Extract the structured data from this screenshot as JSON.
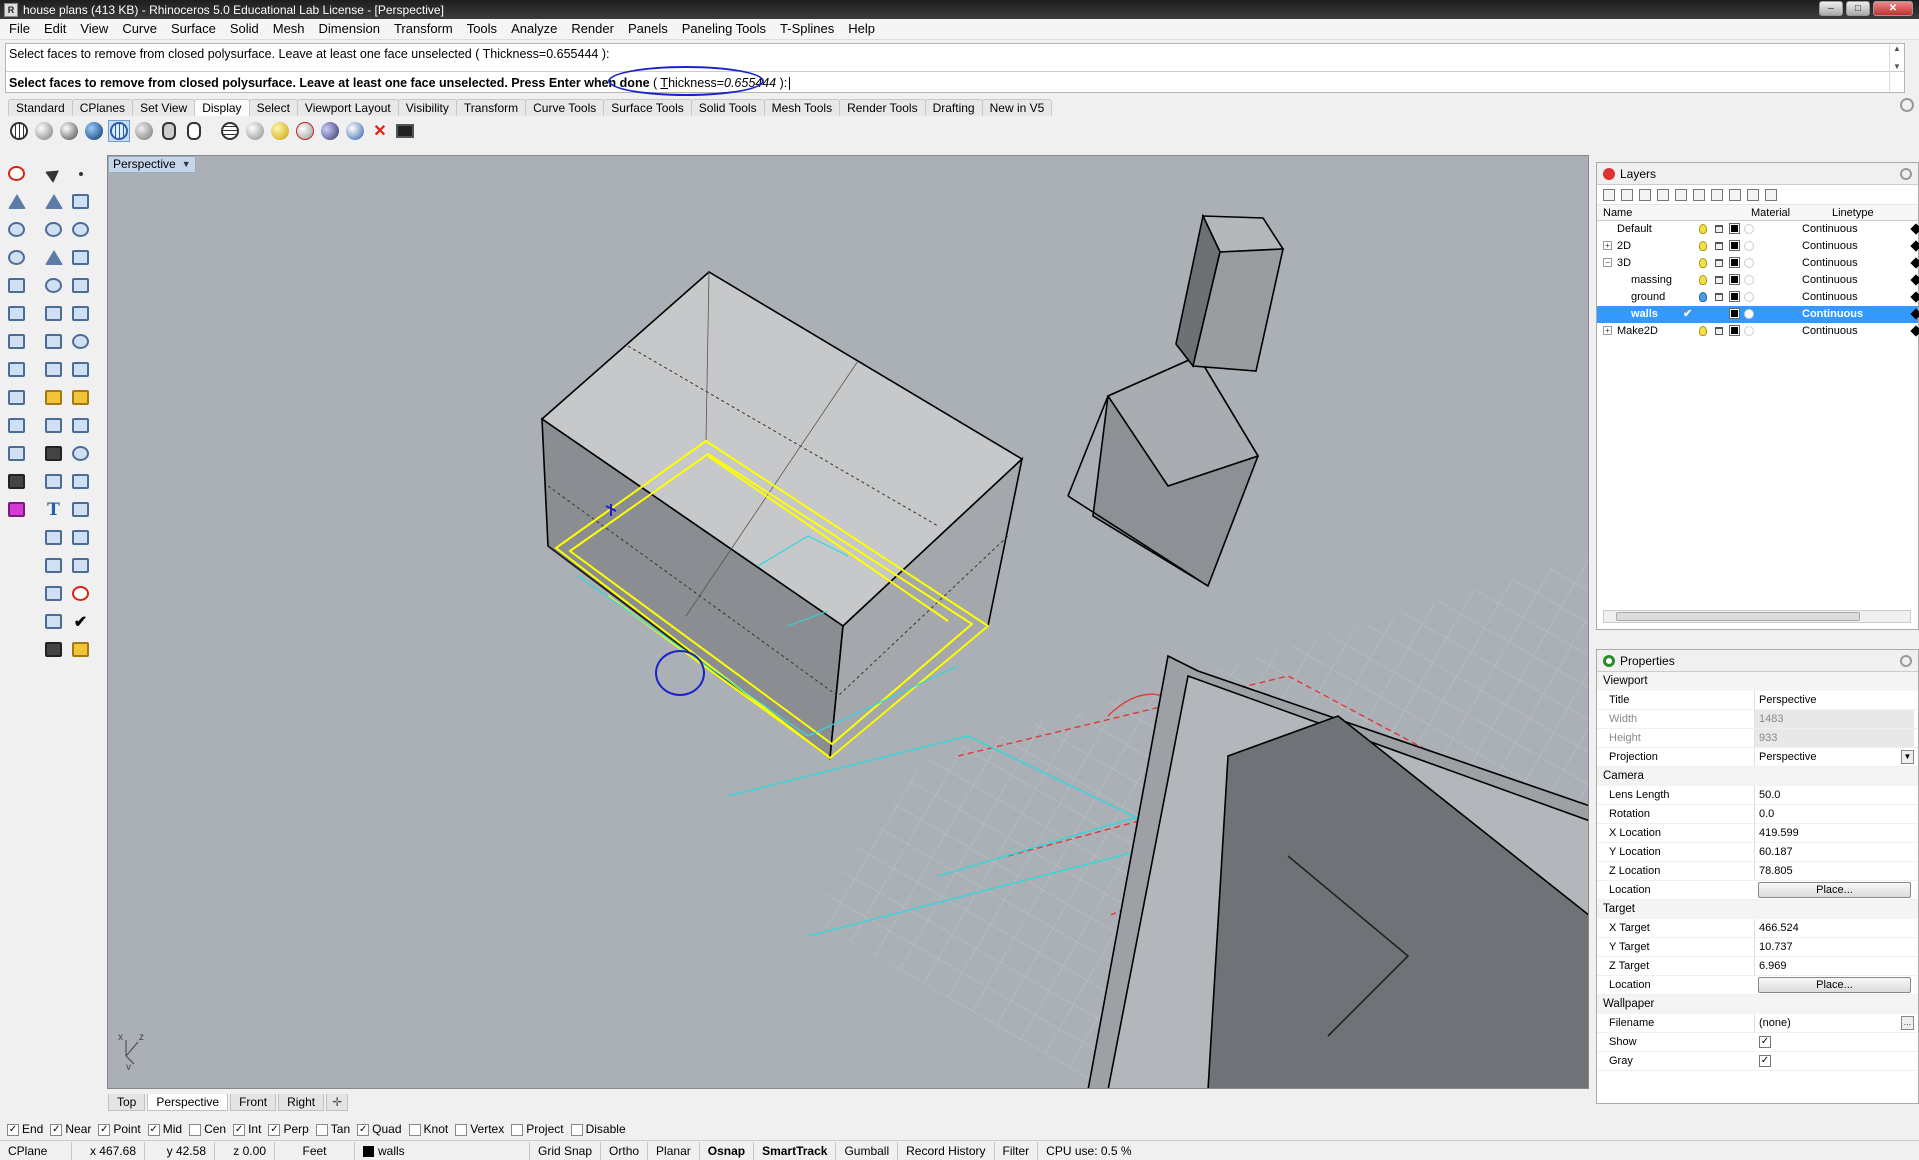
{
  "window": {
    "title": "house plans (413 KB) - Rhinoceros 5.0 Educational Lab License - [Perspective]"
  },
  "menu": [
    "File",
    "Edit",
    "View",
    "Curve",
    "Surface",
    "Solid",
    "Mesh",
    "Dimension",
    "Transform",
    "Tools",
    "Analyze",
    "Render",
    "Panels",
    "Paneling Tools",
    "T-Splines",
    "Help"
  ],
  "command": {
    "history": "Select faces to remove from closed polysurface. Leave at least one face unselected ( Thickness=0.655444 ):",
    "prompt": "Select faces to remove from closed polysurface. Leave at least one face unselected. Press Enter when done",
    "option_open": " ( ",
    "option_key": "T",
    "option_rest": "hickness=",
    "option_value": "0.655444",
    "option_close": " ):"
  },
  "toolbar_tabs": [
    "Standard",
    "CPlanes",
    "Set View",
    "Display",
    "Select",
    "Viewport Layout",
    "Visibility",
    "Transform",
    "Curve Tools",
    "Surface Tools",
    "Solid Tools",
    "Mesh Tools",
    "Render Tools",
    "Drafting",
    "New in V5"
  ],
  "active_toolbar_tab": "Display",
  "viewport": {
    "name": "Perspective",
    "tabs": [
      "Top",
      "Perspective",
      "Front",
      "Right"
    ],
    "active_tab": "Perspective",
    "axis_labels": {
      "x": "x",
      "y": "y",
      "z": "z"
    }
  },
  "layers": {
    "title": "Layers",
    "columns": {
      "name": "Name",
      "material": "Material",
      "linetype": "Linetype"
    },
    "rows": [
      {
        "name": "Default",
        "linetype": "Continuous",
        "expander": "",
        "indent": 0,
        "current": false,
        "selected": false
      },
      {
        "name": "2D",
        "linetype": "Continuous",
        "expander": "+",
        "indent": 0,
        "current": false,
        "selected": false
      },
      {
        "name": "3D",
        "linetype": "Continuous",
        "expander": "−",
        "indent": 0,
        "current": false,
        "selected": false
      },
      {
        "name": "massing",
        "linetype": "Continuous",
        "expander": "",
        "indent": 1,
        "current": false,
        "selected": false
      },
      {
        "name": "ground",
        "linetype": "Continuous",
        "expander": "",
        "indent": 1,
        "current": false,
        "selected": false
      },
      {
        "name": "walls",
        "linetype": "Continuous",
        "expander": "",
        "indent": 1,
        "current": true,
        "selected": true
      },
      {
        "name": "Make2D",
        "linetype": "Continuous",
        "expander": "+",
        "indent": 0,
        "current": false,
        "selected": false
      }
    ]
  },
  "properties": {
    "title": "Properties",
    "viewport_section": "Viewport",
    "title_label": "Title",
    "title_value": "Perspective",
    "width_label": "Width",
    "width_value": "1483",
    "height_label": "Height",
    "height_value": "933",
    "projection_label": "Projection",
    "projection_value": "Perspective",
    "camera_section": "Camera",
    "lens_label": "Lens Length",
    "lens_value": "50.0",
    "rotation_label": "Rotation",
    "rotation_value": "0.0",
    "xloc_label": "X Location",
    "xloc_value": "419.599",
    "yloc_label": "Y Location",
    "yloc_value": "60.187",
    "zloc_label": "Z Location",
    "zloc_value": "78.805",
    "location_label": "Location",
    "place_label": "Place...",
    "target_section": "Target",
    "xtarget_label": "X Target",
    "xtarget_value": "466.524",
    "ytarget_label": "Y Target",
    "ytarget_value": "10.737",
    "ztarget_label": "Z Target",
    "ztarget_value": "6.969",
    "target_location_label": "Location",
    "target_place_label": "Place...",
    "wallpaper_section": "Wallpaper",
    "filename_label": "Filename",
    "filename_value": "(none)",
    "show_label": "Show",
    "show_checked": true,
    "gray_label": "Gray",
    "gray_checked": true
  },
  "osnaps": [
    {
      "label": "End",
      "checked": true
    },
    {
      "label": "Near",
      "checked": true
    },
    {
      "label": "Point",
      "checked": true
    },
    {
      "label": "Mid",
      "checked": true
    },
    {
      "label": "Cen",
      "checked": false
    },
    {
      "label": "Int",
      "checked": true
    },
    {
      "label": "Perp",
      "checked": true
    },
    {
      "label": "Tan",
      "checked": false
    },
    {
      "label": "Quad",
      "checked": true
    },
    {
      "label": "Knot",
      "checked": false
    },
    {
      "label": "Vertex",
      "checked": false
    },
    {
      "label": "Project",
      "checked": false
    },
    {
      "label": "Disable",
      "checked": false
    }
  ],
  "status": {
    "cplane": "CPlane",
    "x": "x 467.68",
    "y": "y 42.58",
    "z": "z 0.00",
    "units": "Feet",
    "layer": "walls",
    "grid_snap": "Grid Snap",
    "ortho": "Ortho",
    "planar": "Planar",
    "osnap": "Osnap",
    "smarttrack": "SmartTrack",
    "gumball": "Gumball",
    "record_history": "Record History",
    "filter": "Filter",
    "cpu": "CPU use: 0.5 %"
  },
  "colors": {
    "selection": "#3399ff",
    "annotation": "#1a22c8",
    "highlight": "#ffff00",
    "viewport_bg": "#aab0b6"
  }
}
